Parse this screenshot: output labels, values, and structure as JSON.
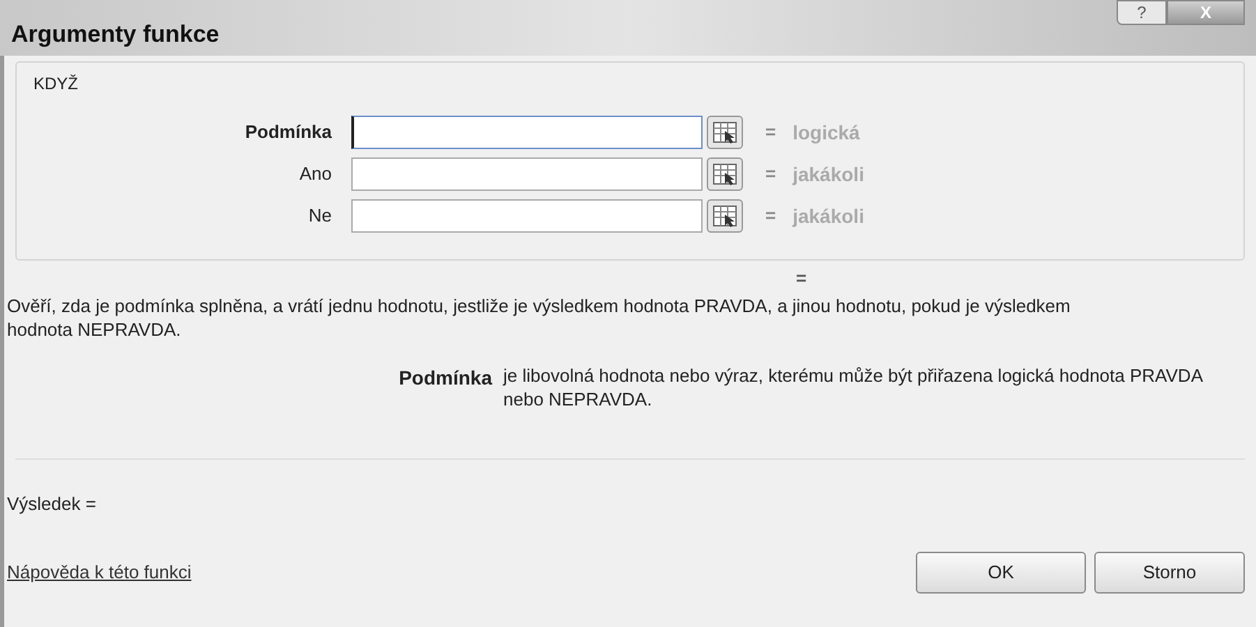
{
  "window": {
    "title": "Argumenty funkce",
    "help_button": "?",
    "close_button": "X"
  },
  "group": {
    "title": "KDYŽ",
    "arguments": [
      {
        "label": "Podmínka",
        "bold": true,
        "focused": true,
        "equals": "=",
        "result": "logická"
      },
      {
        "label": "Ano",
        "bold": false,
        "focused": false,
        "equals": "=",
        "result": "jakákoli"
      },
      {
        "label": "Ne",
        "bold": false,
        "focused": false,
        "equals": "=",
        "result": "jakákoli"
      }
    ]
  },
  "formula_result": "=",
  "description": "Ověří, zda je podmínka splněna, a vrátí jednu hodnotu, jestliže je výsledkem hodnota PRAVDA, a jinou hodnotu, pokud je výsledkem hodnota NEPRAVDA.",
  "argument_help": {
    "name": "Podmínka",
    "text": "je libovolná hodnota nebo výraz, kterému může být přiřazena logická hodnota PRAVDA nebo NEPRAVDA."
  },
  "result_label": "Výsledek =",
  "help_link": "Nápověda k této funkci",
  "buttons": [
    "OK",
    "Storno"
  ]
}
